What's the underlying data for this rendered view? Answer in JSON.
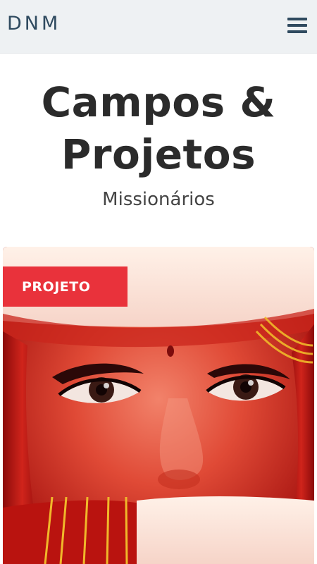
{
  "header": {
    "brand": "DNM",
    "menu_icon": "hamburger-menu-icon"
  },
  "hero": {
    "title_line1": "Campos &",
    "title_line2": "Projetos",
    "subtitle": "Missionários"
  },
  "card": {
    "tag_label": "PROJETO",
    "colors": {
      "tag": "#e9323b",
      "nav_text": "#2f4a5f"
    }
  }
}
